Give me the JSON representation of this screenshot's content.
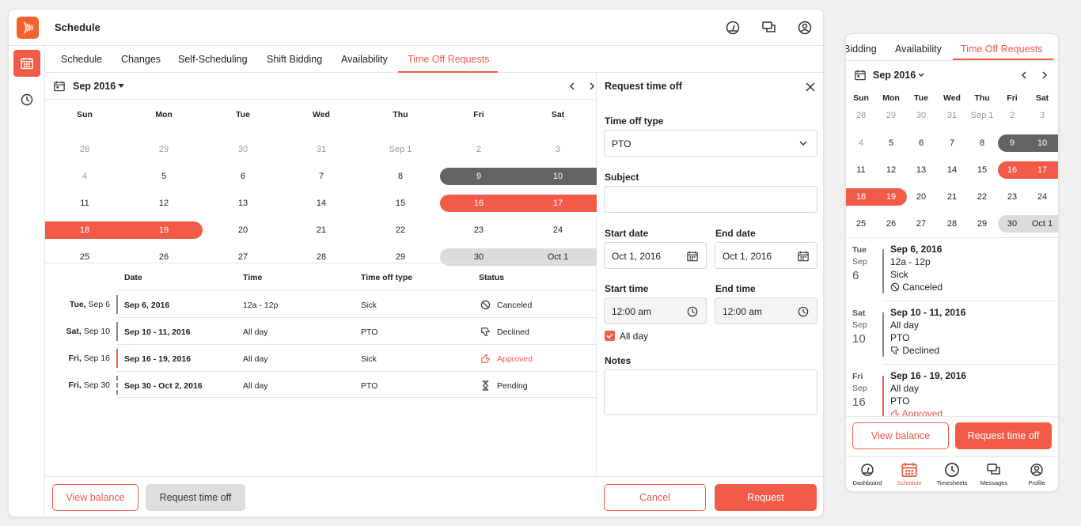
{
  "app": {
    "title": "Schedule"
  },
  "tabs": [
    "Schedule",
    "Changes",
    "Self-Scheduling",
    "Shift Bidding",
    "Availability",
    "Time Off Requests"
  ],
  "calendar": {
    "month_label": "Sep 2016",
    "weekdays": [
      "Sun",
      "Mon",
      "Tue",
      "Wed",
      "Thu",
      "Fri",
      "Sat"
    ],
    "weeks": [
      [
        "28",
        "29",
        "30",
        "31",
        "Sep 1",
        "2",
        "3"
      ],
      [
        "4",
        "5",
        "6",
        "7",
        "8",
        "9",
        "10"
      ],
      [
        "11",
        "12",
        "13",
        "14",
        "15",
        "16",
        "17"
      ],
      [
        "18",
        "19",
        "20",
        "21",
        "22",
        "23",
        "24"
      ],
      [
        "25",
        "26",
        "27",
        "28",
        "29",
        "30",
        "Oct 1"
      ]
    ]
  },
  "table": {
    "headers": {
      "date": "Date",
      "time": "Time",
      "type": "Time off type",
      "status": "Status"
    },
    "rows": [
      {
        "label_day": "Tue,",
        "label_date": "Sep 6",
        "date": "Sep 6, 2016",
        "time": "12a - 12p",
        "type": "Sick",
        "status": "Canceled"
      },
      {
        "label_day": "Sat,",
        "label_date": "Sep 10",
        "date": "Sep 10 - 11, 2016",
        "time": "All day",
        "type": "PTO",
        "status": "Declined"
      },
      {
        "label_day": "Fri,",
        "label_date": "Sep 16",
        "date": "Sep 16 - 19, 2016",
        "time": "All day",
        "type": "Sick",
        "status": "Approved"
      },
      {
        "label_day": "Fri,",
        "label_date": "Sep 30",
        "date": "Sep 30 - Oct 2, 2016",
        "time": "All day",
        "type": "PTO",
        "status": "Pending"
      }
    ]
  },
  "footer": {
    "view_balance": "View balance",
    "request_time_off": "Request time off"
  },
  "panel": {
    "title": "Request time off",
    "type_label": "Time off type",
    "type_value": "PTO",
    "subject_label": "Subject",
    "subject_value": "",
    "start_date_label": "Start date",
    "start_date_value": "Oct 1, 2016",
    "end_date_label": "End date",
    "end_date_value": "Oct 1, 2016",
    "start_time_label": "Start time",
    "start_time_value": "12:00 am",
    "end_time_label": "End time",
    "end_time_value": "12:00 am",
    "all_day_label": "All day",
    "notes_label": "Notes",
    "cancel": "Cancel",
    "request": "Request"
  },
  "mobile": {
    "tabs": [
      "Bidding",
      "Availability",
      "Time Off Requests"
    ],
    "month_label": "Sep 2016",
    "weekdays": [
      "Sun",
      "Mon",
      "Tue",
      "Wed",
      "Thu",
      "Fri",
      "Sat"
    ],
    "weeks": [
      [
        "28",
        "29",
        "30",
        "31",
        "Sep 1",
        "2",
        "3"
      ],
      [
        "4",
        "5",
        "6",
        "7",
        "8",
        "9",
        "10"
      ],
      [
        "11",
        "12",
        "13",
        "14",
        "15",
        "16",
        "17"
      ],
      [
        "18",
        "19",
        "20",
        "21",
        "22",
        "23",
        "24"
      ],
      [
        "25",
        "26",
        "27",
        "28",
        "29",
        "30",
        "Oct 1"
      ]
    ],
    "items": [
      {
        "dow": "Tue",
        "mon": "Sep",
        "day": "6",
        "date": "Sep 6, 2016",
        "time": "12a - 12p",
        "type": "Sick",
        "status": "Canceled"
      },
      {
        "dow": "Sat",
        "mon": "Sep",
        "day": "10",
        "date": "Sep 10 - 11, 2016",
        "time": "All day",
        "type": "PTO",
        "status": "Declined"
      },
      {
        "dow": "Fri",
        "mon": "Sep",
        "day": "16",
        "date": "Sep 16 - 19, 2016",
        "time": "All day",
        "type": "PTO",
        "status": "Approved"
      }
    ],
    "view_balance": "View balance",
    "request_time_off": "Request time off",
    "nav": [
      "Dashboard",
      "Schedule",
      "Timesheets",
      "Messages",
      "Profile"
    ]
  },
  "colors": {
    "accent": "#f25b47",
    "logo": "#f2632f",
    "dark_pill": "#636366",
    "light_pill": "#dcdcdc"
  }
}
